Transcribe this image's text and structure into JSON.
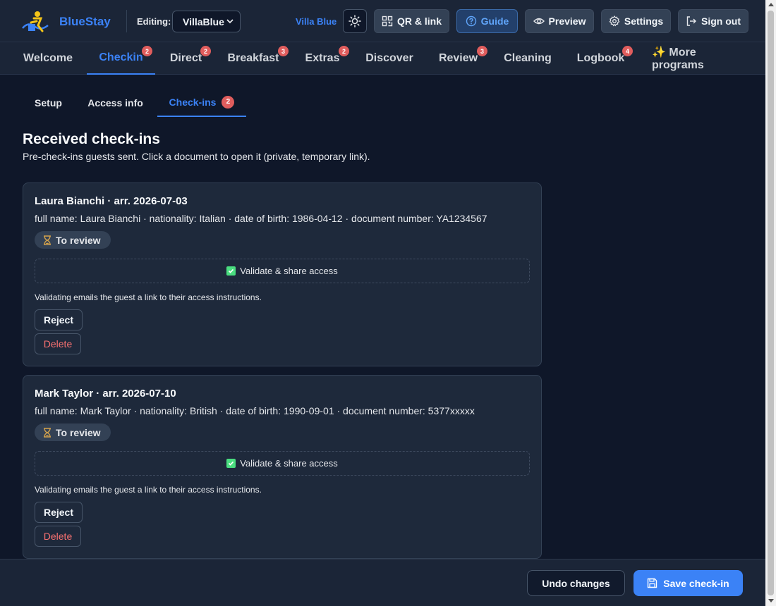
{
  "header": {
    "brand": "BlueStay",
    "editing_label": "Editing:",
    "property_selected": "VillaBlue",
    "villa_name": "Villa Blue",
    "buttons": {
      "qr": "QR & link",
      "guide": "Guide",
      "preview": "Preview",
      "settings": "Settings",
      "signout": "Sign out"
    }
  },
  "nav": {
    "tabs": [
      {
        "label": "Welcome",
        "badge": ""
      },
      {
        "label": "Checkin",
        "badge": "2"
      },
      {
        "label": "Direct",
        "badge": "2"
      },
      {
        "label": "Breakfast",
        "badge": "3"
      },
      {
        "label": "Extras",
        "badge": "2"
      },
      {
        "label": "Discover",
        "badge": ""
      },
      {
        "label": "Review",
        "badge": "3"
      },
      {
        "label": "Cleaning",
        "badge": ""
      },
      {
        "label": "Logbook",
        "badge": "4"
      },
      {
        "label": "✨ More programs",
        "badge": ""
      }
    ]
  },
  "subtabs": [
    {
      "label": "Setup"
    },
    {
      "label": "Access info"
    },
    {
      "label": "Check-ins",
      "badge": "2"
    }
  ],
  "section": {
    "title": "Received check-ins",
    "subtitle": "Pre-check-ins guests sent. Click a document to open it (private, temporary link)."
  },
  "checkins": [
    {
      "title": "Laura Bianchi · arr. 2026-07-03",
      "meta": "full name: Laura Bianchi · nationality: Italian · date of birth: 1986-04-12 · document number: YA1234567",
      "status": "To review",
      "validate_label": "Validate & share access",
      "hint": "Validating emails the guest a link to their access instructions.",
      "reject_label": "Reject",
      "delete_label": "Delete"
    },
    {
      "title": "Mark Taylor · arr. 2026-07-10",
      "meta": "full name: Mark Taylor · nationality: British · date of birth: 1990-09-01 · document number: 5377xxxxx",
      "status": "To review",
      "validate_label": "Validate & share access",
      "hint": "Validating emails the guest a link to their access instructions.",
      "reject_label": "Reject",
      "delete_label": "Delete"
    }
  ],
  "footer": {
    "undo_label": "Undo changes",
    "save_label": "Save check-in"
  },
  "colors": {
    "accent": "#3b82f6",
    "badge": "#e05d5d",
    "danger": "#f87171",
    "background": "#0f1729",
    "surface": "#1e293b"
  },
  "icons": {
    "theme": "sun-icon",
    "qr": "qr-grid-icon",
    "guide": "help-circle-icon",
    "preview": "eye-icon",
    "settings": "gear-icon",
    "signout": "logout-icon",
    "status": "hourglass-icon",
    "validate": "check-box-icon",
    "save": "floppy-disk-icon"
  }
}
